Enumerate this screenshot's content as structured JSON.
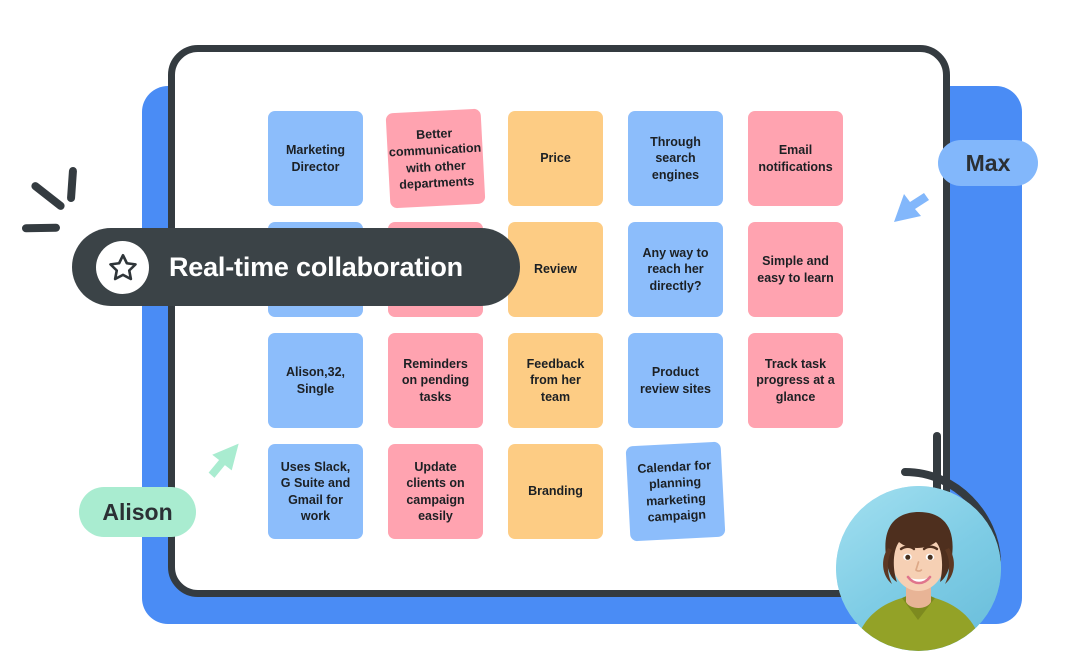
{
  "board": {
    "columns": 5,
    "rows": 4,
    "cards": [
      {
        "row": 1,
        "col": 1,
        "color": "blue",
        "text": "Marketing Director"
      },
      {
        "row": 1,
        "col": 2,
        "color": "pink",
        "text": "Better communication with other departments",
        "rotate": -3
      },
      {
        "row": 1,
        "col": 3,
        "color": "orange",
        "text": "Price"
      },
      {
        "row": 1,
        "col": 4,
        "color": "blue",
        "text": "Through search engines"
      },
      {
        "row": 1,
        "col": 5,
        "color": "pink",
        "text": "Email notifications"
      },
      {
        "row": 2,
        "col": 1,
        "color": "blue",
        "text": ""
      },
      {
        "row": 2,
        "col": 2,
        "color": "pink",
        "text": ""
      },
      {
        "row": 2,
        "col": 3,
        "color": "orange",
        "text": "Review"
      },
      {
        "row": 2,
        "col": 4,
        "color": "blue",
        "text": "Any way to reach her directly?"
      },
      {
        "row": 2,
        "col": 5,
        "color": "pink",
        "text": "Simple and easy to learn"
      },
      {
        "row": 3,
        "col": 1,
        "color": "blue",
        "text": "Alison,32, Single"
      },
      {
        "row": 3,
        "col": 2,
        "color": "pink",
        "text": "Reminders on pending tasks"
      },
      {
        "row": 3,
        "col": 3,
        "color": "orange",
        "text": "Feedback from her team"
      },
      {
        "row": 3,
        "col": 4,
        "color": "blue",
        "text": "Product review sites"
      },
      {
        "row": 3,
        "col": 5,
        "color": "pink",
        "text": "Track task progress at a glance"
      },
      {
        "row": 4,
        "col": 1,
        "color": "blue",
        "text": "Uses Slack, G Suite and Gmail for work"
      },
      {
        "row": 4,
        "col": 2,
        "color": "pink",
        "text": "Update clients on campaign easily"
      },
      {
        "row": 4,
        "col": 3,
        "color": "orange",
        "text": "Branding"
      },
      {
        "row": 4,
        "col": 4,
        "color": "blue",
        "text": "Calendar for planning marketing campaign",
        "rotate": -3
      }
    ]
  },
  "banner": {
    "label": "Real-time collaboration",
    "icon": "star-icon"
  },
  "collaborators": [
    {
      "name": "Alison",
      "pill_color": "#a9ecd0",
      "cursor_color": "#a9ecd0"
    },
    {
      "name": "Max",
      "pill_color": "#82b7fb",
      "cursor_color": "#82b7fb"
    }
  ],
  "avatar": {
    "alt": "Alison profile photo",
    "background_color": "#7ccbe4",
    "shirt_color": "#93a227"
  },
  "colors": {
    "blue_card": "#8cbdfb",
    "pink_card": "#ffa3b0",
    "orange_card": "#fdcc84",
    "frame_stroke": "#343b40",
    "backdrop_blue": "#4a8cf5",
    "banner_dark": "#3b4347"
  }
}
